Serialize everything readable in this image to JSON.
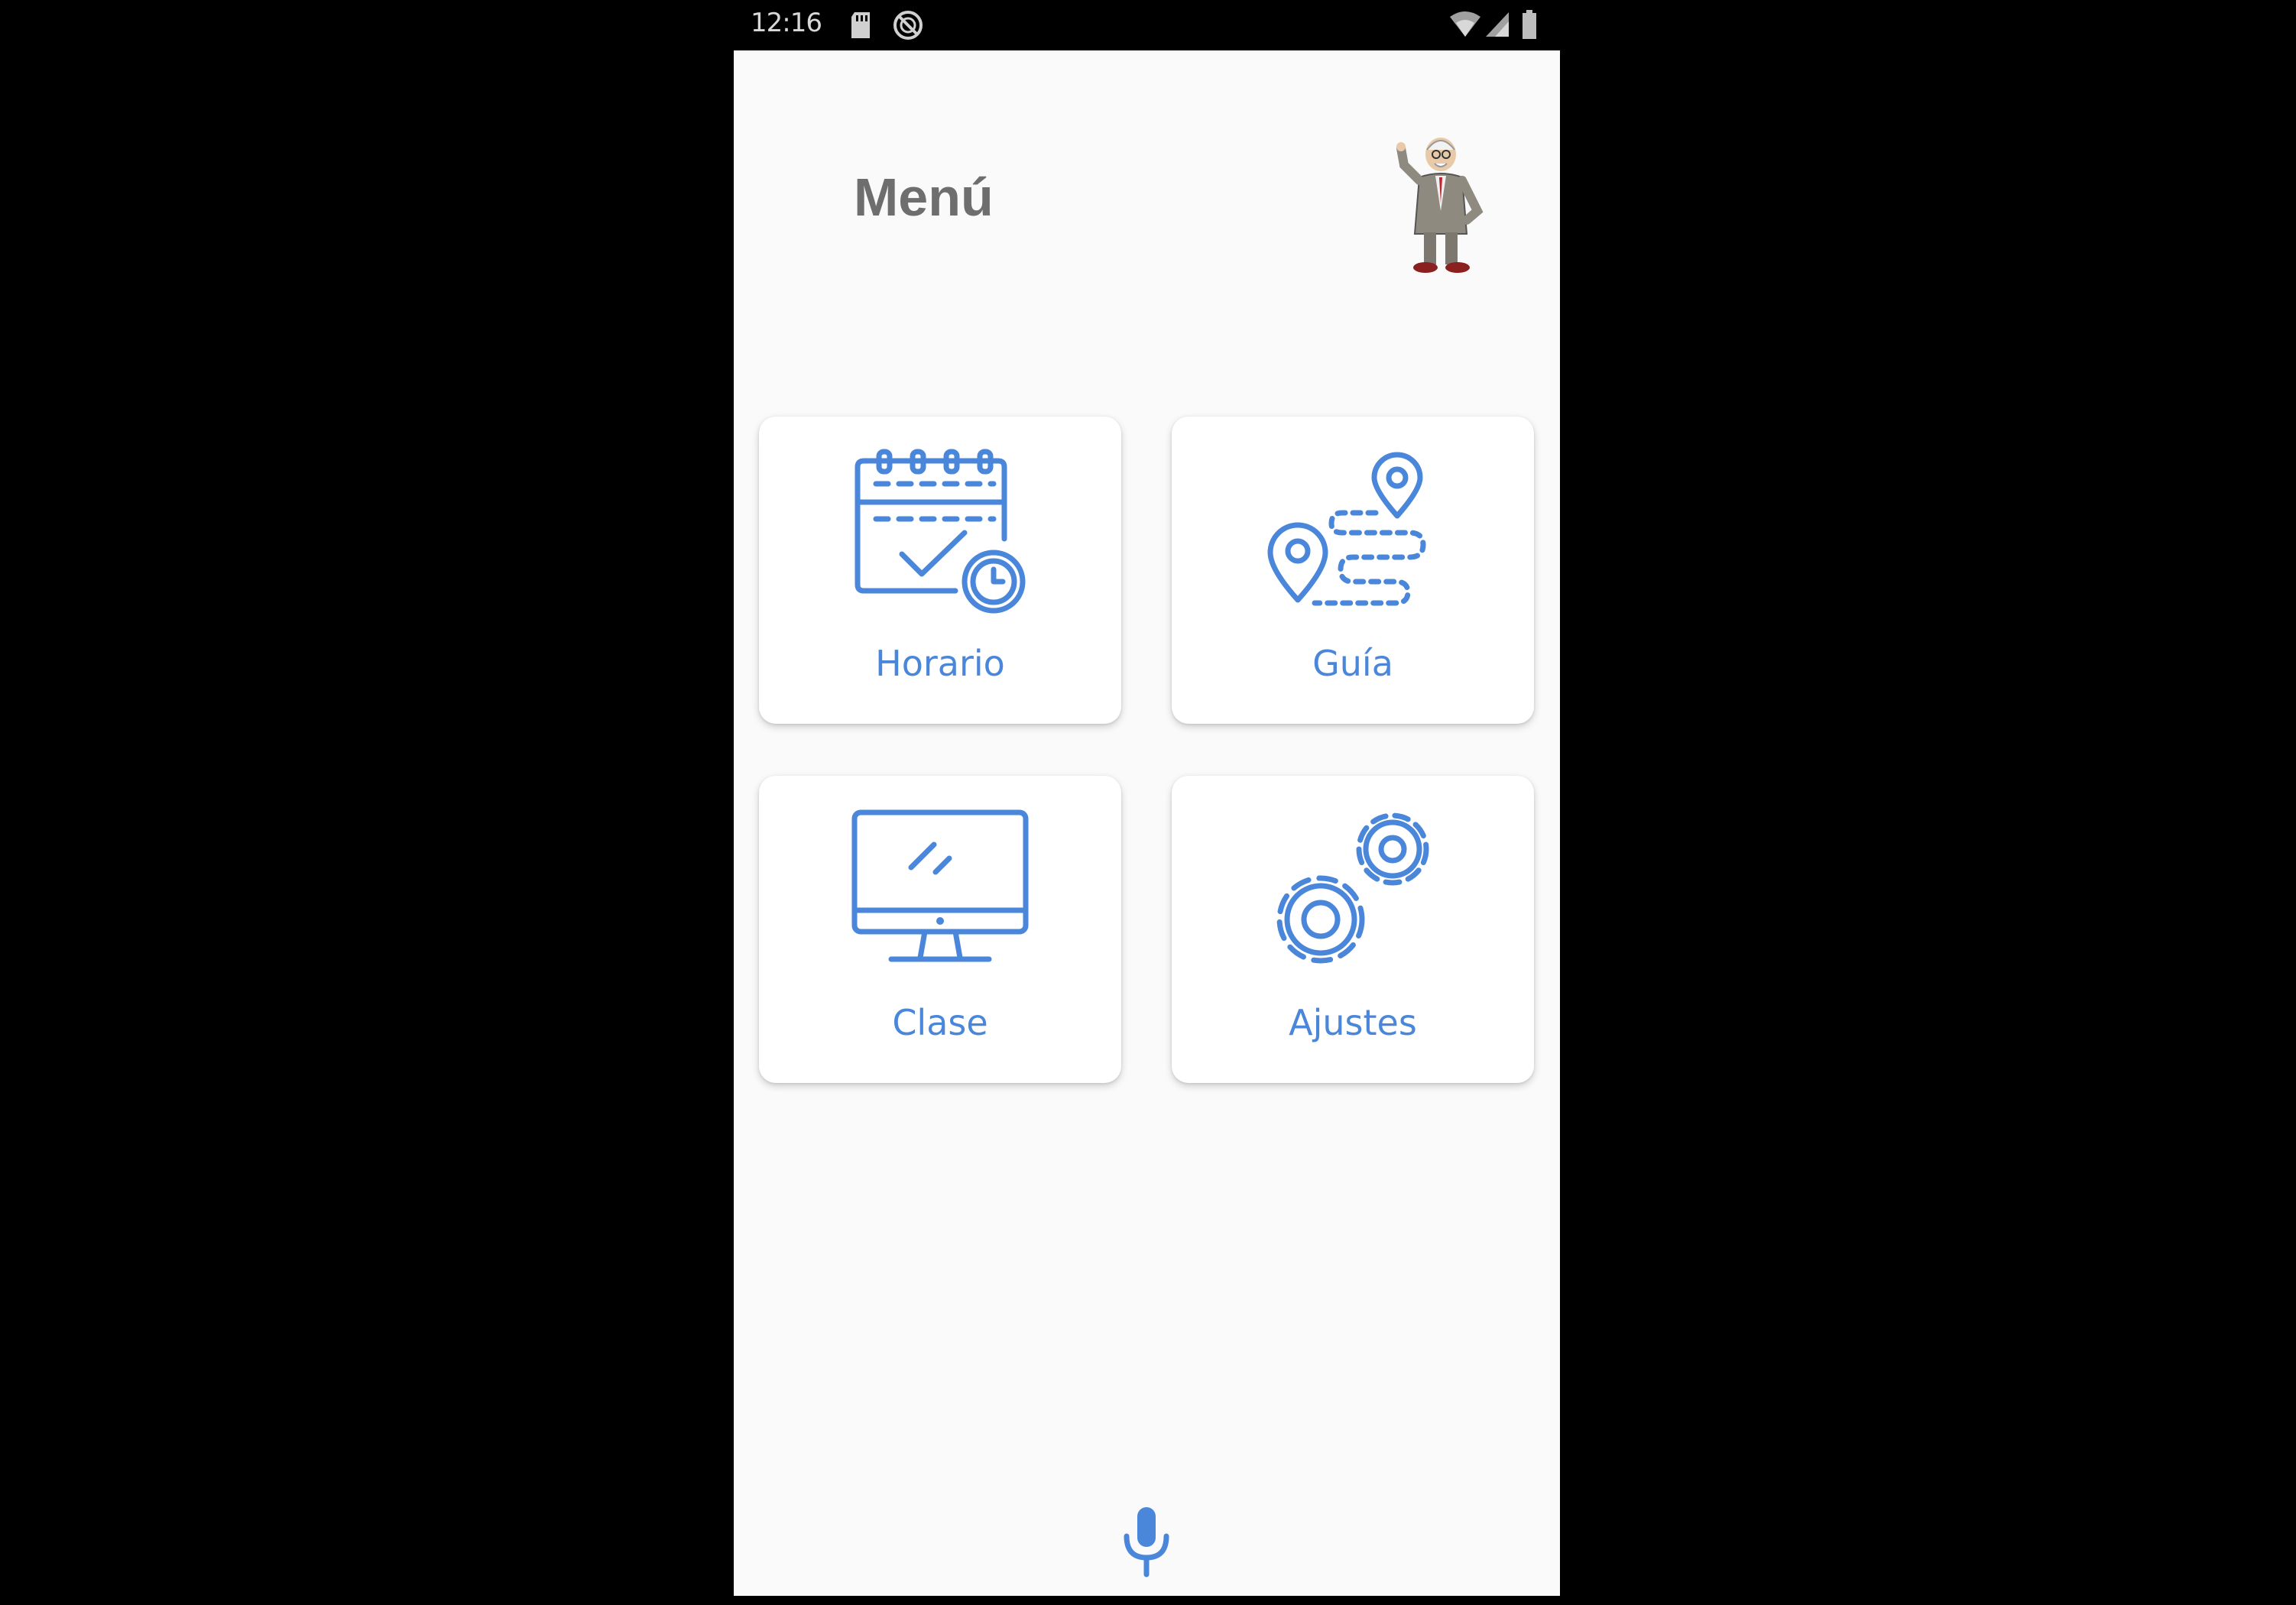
{
  "status_bar": {
    "time": "12:16",
    "icons": [
      "sd-card-icon",
      "no-sync-icon",
      "wifi-icon",
      "signal-icon",
      "battery-icon"
    ]
  },
  "header": {
    "title": "Menú",
    "avatar_icon": "cartoon-professor-icon"
  },
  "menu": {
    "accent_color": "#4a86d9",
    "items": [
      {
        "label": "Horario",
        "icon": "calendar-check-icon"
      },
      {
        "label": "Guía",
        "icon": "route-map-pins-icon"
      },
      {
        "label": "Clase",
        "icon": "monitor-icon"
      },
      {
        "label": "Ajustes",
        "icon": "gears-icon"
      }
    ]
  },
  "footer": {
    "mic_icon": "microphone-icon"
  }
}
